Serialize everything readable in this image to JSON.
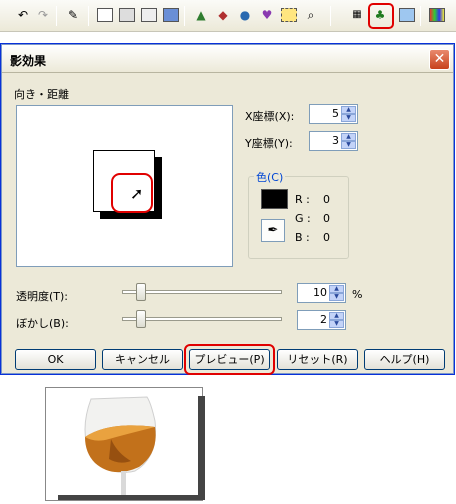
{
  "toolbar": {
    "icons": [
      "undo-icon",
      "redo-icon",
      "pen-icon",
      "frame-icon",
      "frame-alt-icon",
      "frame-text-icon",
      "photo-icon",
      "landscape-icon",
      "box-icon",
      "shapes-icon",
      "brush-icon",
      "crop-icon",
      "zoom-icon",
      "grid-icon",
      "shadow-tree-icon",
      "picture-icon",
      "palette-icon"
    ]
  },
  "dialog": {
    "title": "影効果",
    "close": "✕",
    "direction_label": "向き・距離",
    "x_label": "X座標(X):",
    "y_label": "Y座標(Y):",
    "x_value": "5",
    "y_value": "3",
    "color_legend": "色(C)",
    "r_label": "R :",
    "r_value": "0",
    "g_label": "G :",
    "g_value": "0",
    "b_label": "B :",
    "b_value": "0",
    "color_value": "#000000",
    "opacity_label": "透明度(T):",
    "opacity_value": "10",
    "opacity_unit": "%",
    "blur_label": "ぼかし(B):",
    "blur_value": "2",
    "buttons": {
      "ok": "OK",
      "cancel": "キャンセル",
      "preview": "プレビュー(P)",
      "reset": "リセット(R)",
      "help": "ヘルプ(H)"
    }
  }
}
